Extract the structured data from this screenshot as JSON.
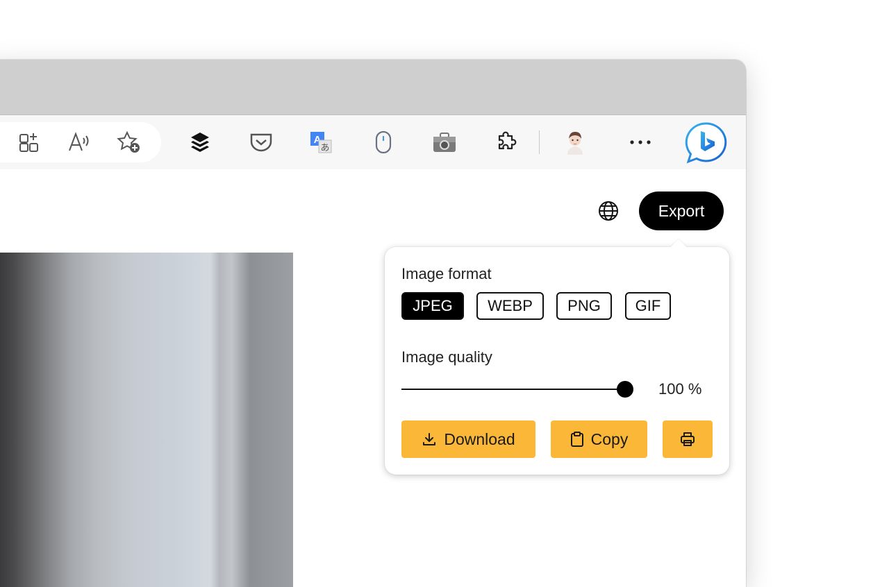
{
  "toolbar": {
    "icons": [
      "add-tab-group-icon",
      "read-aloud-icon",
      "add-favorite-icon",
      "buffer-extension-icon",
      "pocket-extension-icon",
      "translate-extension-icon",
      "mouse-extension-icon",
      "screenshot-extension-icon",
      "extensions-icon",
      "profile-avatar",
      "more-menu-icon",
      "bing-copilot-icon"
    ],
    "more_label": "···"
  },
  "page": {
    "export_label": "Export"
  },
  "export_panel": {
    "format_title": "Image format",
    "formats": [
      "JPEG",
      "WEBP",
      "PNG",
      "GIF"
    ],
    "selected_format": "JPEG",
    "quality_title": "Image quality",
    "quality_value": 100,
    "quality_text": "100 %",
    "download_label": "Download",
    "copy_label": "Copy"
  },
  "colors": {
    "accent": "#fbb838",
    "primary": "#000000",
    "bing_blue": "#1e7be0"
  }
}
